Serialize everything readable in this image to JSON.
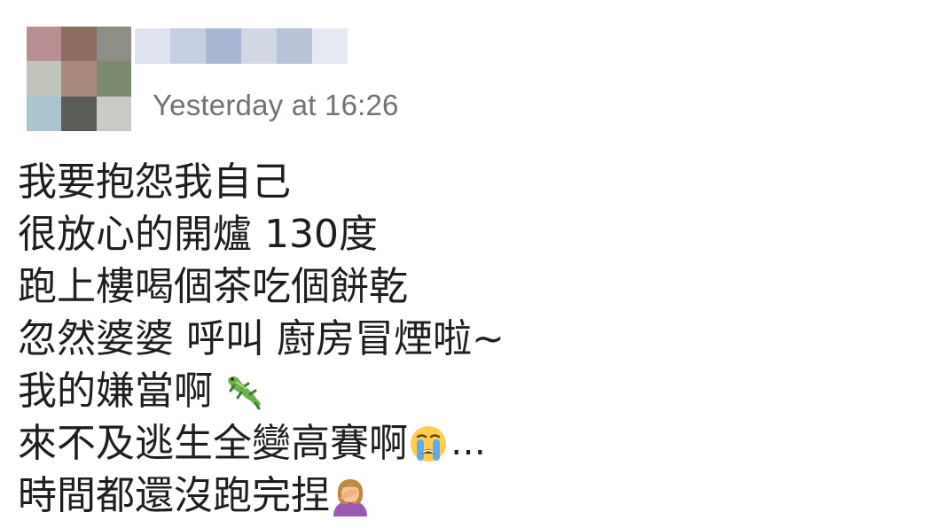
{
  "post": {
    "timestamp": "Yesterday at 16:26",
    "avatar_pixels": [
      "#b98f94",
      "#8b6e5d",
      "#8e8e86",
      "#c0c4bb",
      "#a98a7a",
      "#7c8a6e",
      "#a9c4cf",
      "#5b5b57",
      "#c9cac4"
    ],
    "name_blur_pixels": [
      "#dfe3ef",
      "#c7d0e2",
      "#a9b8d4",
      "#d2d8e6",
      "#b8c3da",
      "#e6e9f1"
    ],
    "lines": [
      {
        "text": "我要抱怨我自己"
      },
      {
        "text": "很放心的開爐 130度"
      },
      {
        "text": "跑上樓喝個茶吃個餅乾"
      },
      {
        "text": "忽然婆婆 呼叫 廚房冒煙啦~"
      },
      {
        "text": "我的嫌當啊",
        "emoji": "lizard-emoji"
      },
      {
        "text": "來不及逃生全變高賽啊",
        "emoji": "crying-face-emoji",
        "suffix": "…"
      },
      {
        "text": "時間都還沒跑完捏",
        "emoji": "facepalm-woman-emoji"
      }
    ]
  }
}
